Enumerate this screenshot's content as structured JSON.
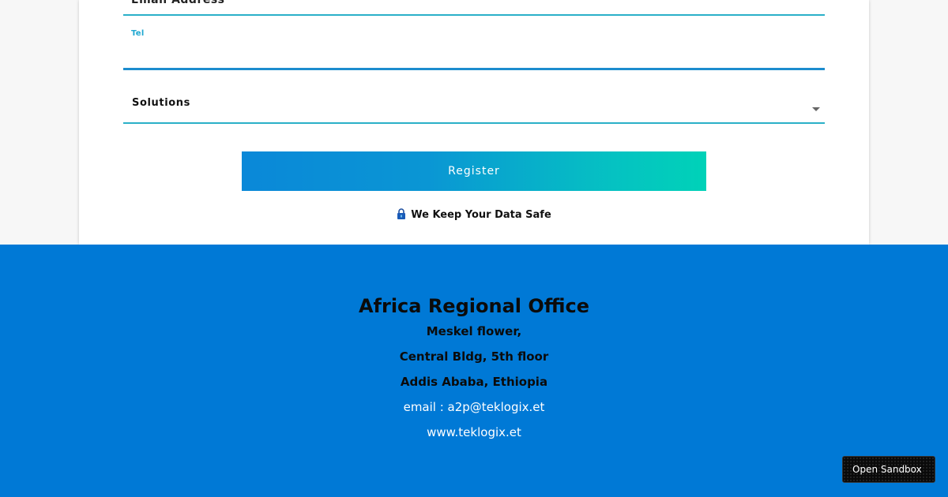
{
  "form": {
    "email_label": "Email Address",
    "tel_label": "Tel",
    "tel_value": "",
    "solutions_label": "Solutions",
    "register_label": "Register",
    "safe_text": "We Keep Your Data Safe",
    "lock_icon": "lock-icon"
  },
  "footer": {
    "title": "Africa Regional Office",
    "address": [
      "Meskel flower,",
      "Central Bldg, 5th floor",
      "Addis Ababa, Ethiopia"
    ],
    "email": "email : a2p@teklogix.et",
    "website": "www.teklogix.et"
  },
  "sandbox": {
    "label": "Open Sandbox"
  },
  "colors": {
    "accent_teal": "#2ab0c8",
    "footer_blue": "#0079d6",
    "button_gradient_start": "#0a88d8",
    "button_gradient_end": "#00d2b8"
  }
}
